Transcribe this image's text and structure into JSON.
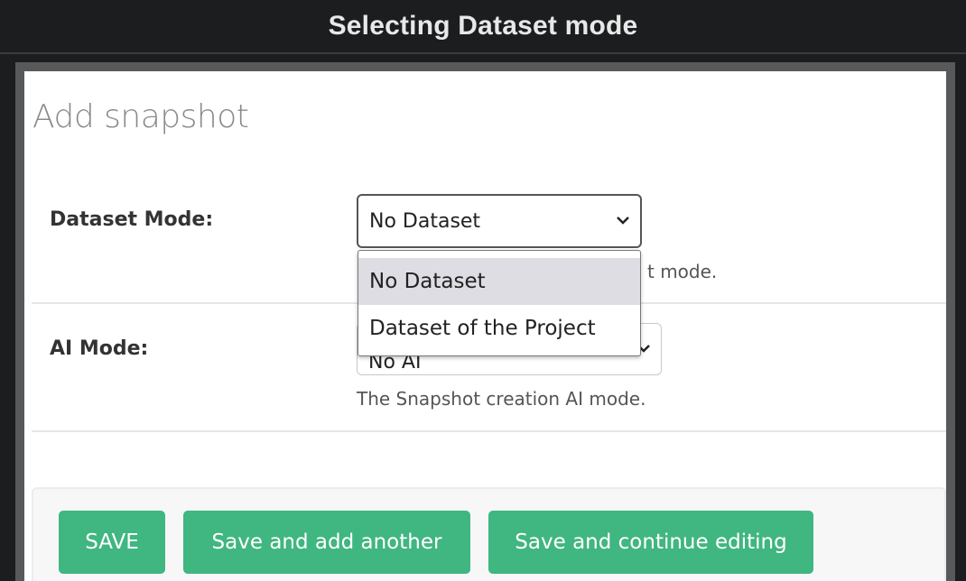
{
  "window": {
    "title": "Selecting Dataset mode"
  },
  "form": {
    "heading": "Add snapshot",
    "dataset_mode": {
      "label": "Dataset Mode:",
      "selected_value": "No Dataset",
      "help_text_visible": "t mode.",
      "options": [
        "No Dataset",
        "Dataset of the Project"
      ],
      "highlighted_option": "No Dataset"
    },
    "ai_mode": {
      "label": "AI Mode:",
      "selected_value_partial": "No AI",
      "help_text": "The Snapshot creation AI mode."
    }
  },
  "actions": {
    "save_label": "SAVE",
    "save_add_label": "Save and add another",
    "save_continue_label": "Save and continue editing"
  },
  "colors": {
    "button_green": "#40b681",
    "dropdown_highlight": "#dedde3",
    "title_bar_bg": "#1c1d1f"
  }
}
